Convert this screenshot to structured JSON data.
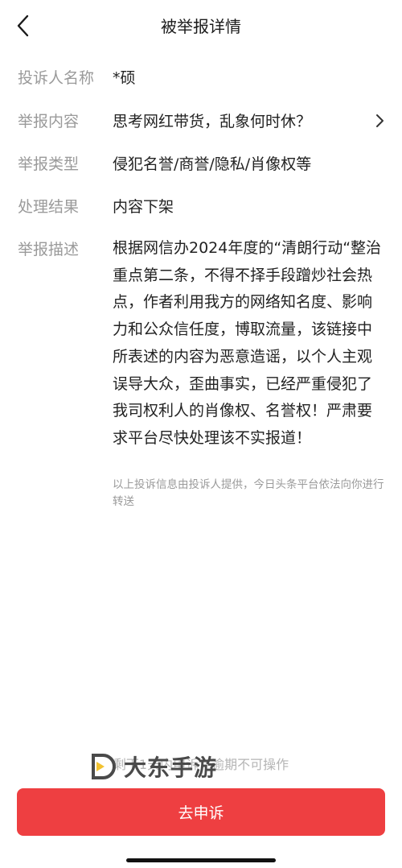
{
  "header": {
    "title": "被举报详情",
    "back_icon": "chevron-left-icon"
  },
  "details": {
    "complainant": {
      "label": "投诉人名称",
      "value": "*硕"
    },
    "content": {
      "label": "举报内容",
      "value": "思考网红带货，乱象何时休？",
      "icon": "chevron-right-icon"
    },
    "type": {
      "label": "举报类型",
      "value": "侵犯名誉/商誉/隐私/肖像权等"
    },
    "result": {
      "label": "处理结果",
      "value": "内容下架"
    },
    "description": {
      "label": "举报描述",
      "value": "根据网信办2024年度的“清朗行动“整治重点第二条，不得不择手段蹭炒社会热点，作者利用我方的网络知名度、影响力和公众信任度，博取流量，该链接中所表述的内容为恶意造谣，以个人主观误导大众，歪曲事实，已经严重侵犯了我司权利人的肖像权、名誉权！严肃要求平台尽快处理该不实报道！"
    },
    "note": "以上投诉信息由投诉人提供，今日头条平台依法向你进行转送"
  },
  "footer": {
    "deadline_text": "剩下1天内申诉，逾期不可操作",
    "appeal_button": "去申诉"
  },
  "watermark": {
    "text": "大东手游",
    "icon": "dd-logo-icon"
  },
  "colors": {
    "accent": "#ee3f41",
    "label_gray": "#9a9a9a",
    "text": "#222222"
  }
}
